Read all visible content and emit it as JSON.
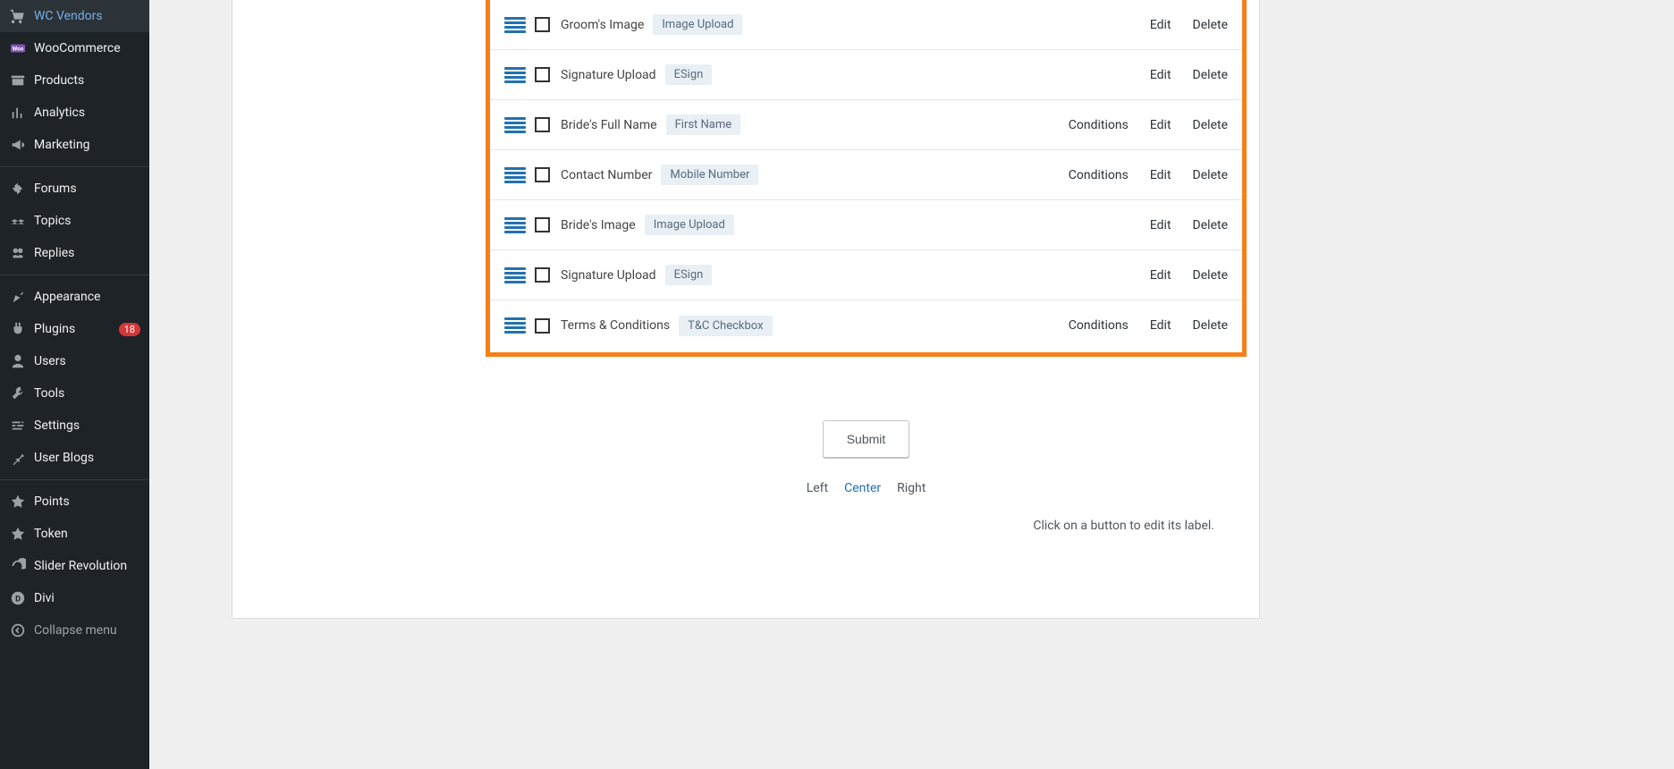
{
  "sidebar": {
    "items": [
      {
        "icon": "cart",
        "label": "WC Vendors"
      },
      {
        "icon": "woo",
        "label": "WooCommerce"
      },
      {
        "icon": "archive",
        "label": "Products"
      },
      {
        "icon": "chart",
        "label": "Analytics"
      },
      {
        "icon": "megaphone",
        "label": "Marketing"
      },
      {
        "sep": true
      },
      {
        "icon": "forum",
        "label": "Forums"
      },
      {
        "icon": "topic",
        "label": "Topics"
      },
      {
        "icon": "reply",
        "label": "Replies"
      },
      {
        "sep": true
      },
      {
        "icon": "appearance",
        "label": "Appearance"
      },
      {
        "icon": "plugin",
        "label": "Plugins",
        "badge": "18"
      },
      {
        "icon": "user",
        "label": "Users"
      },
      {
        "icon": "tool",
        "label": "Tools"
      },
      {
        "icon": "settings",
        "label": "Settings"
      },
      {
        "icon": "pin",
        "label": "User Blogs"
      },
      {
        "sep": true
      },
      {
        "icon": "star",
        "label": "Points"
      },
      {
        "icon": "star",
        "label": "Token"
      },
      {
        "icon": "refresh",
        "label": "Slider Revolution"
      },
      {
        "icon": "divi",
        "label": "Divi"
      },
      {
        "collapse": true,
        "icon": "collapse",
        "label": "Collapse menu"
      }
    ]
  },
  "form": {
    "rows": [
      {
        "label": "Groom's Image",
        "badge": "Image Upload",
        "actions": [
          "Edit",
          "Delete"
        ]
      },
      {
        "label": "Signature Upload",
        "badge": "ESign",
        "actions": [
          "Edit",
          "Delete"
        ]
      },
      {
        "label": "Bride's Full Name",
        "badge": "First Name",
        "actions": [
          "Conditions",
          "Edit",
          "Delete"
        ]
      },
      {
        "label": "Contact Number",
        "badge": "Mobile Number",
        "actions": [
          "Conditions",
          "Edit",
          "Delete"
        ]
      },
      {
        "label": "Bride's Image",
        "badge": "Image Upload",
        "actions": [
          "Edit",
          "Delete"
        ]
      },
      {
        "label": "Signature Upload",
        "badge": "ESign",
        "actions": [
          "Edit",
          "Delete"
        ]
      },
      {
        "label": "Terms & Conditions",
        "badge": "T&C Checkbox",
        "actions": [
          "Conditions",
          "Edit",
          "Delete"
        ]
      }
    ],
    "submit_label": "Submit",
    "alignment": {
      "left": "Left",
      "center": "Center",
      "right": "Right",
      "active": "center"
    },
    "hint": "Click on a button to edit its label."
  }
}
